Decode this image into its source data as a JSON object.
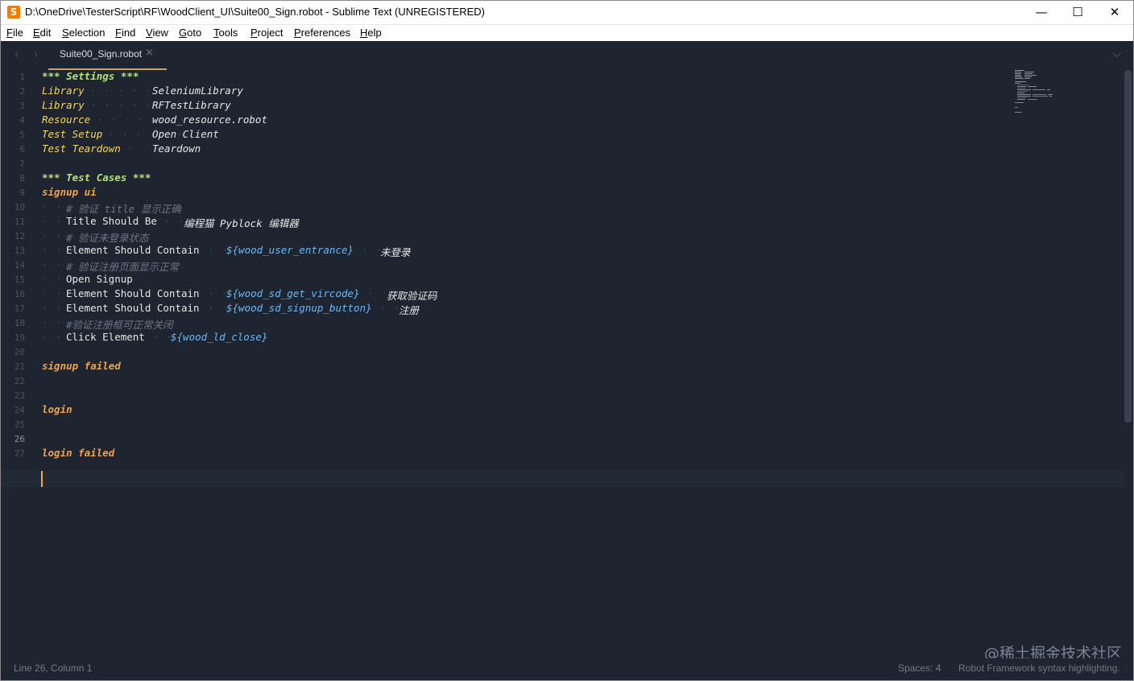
{
  "window": {
    "title": "D:\\OneDrive\\TesterScript\\RF\\WoodClient_UI\\Suite00_Sign.robot - Sublime Text (UNREGISTERED)",
    "app_icon": "sublime-s-logo",
    "minimize_glyph": "—",
    "maximize_glyph": "☐",
    "close_glyph": "✕"
  },
  "menu": [
    "File",
    "Edit",
    "Selection",
    "Find",
    "View",
    "Goto",
    "Tools",
    "Project",
    "Preferences",
    "Help"
  ],
  "tabs": {
    "back_glyph": "‹",
    "forward_glyph": "›",
    "active_label": "Suite00_Sign.robot",
    "close_glyph": "×",
    "dropdown_glyph": "⌵"
  },
  "editor": {
    "line_numbers": [
      "1",
      "2",
      "3",
      "4",
      "5",
      "6",
      "7",
      "8",
      "9",
      "10",
      "11",
      "12",
      "13",
      "14",
      "15",
      "16",
      "17",
      "18",
      "19",
      "20",
      "21",
      "22",
      "23",
      "24",
      "25",
      "26",
      "27"
    ],
    "current_line": "26",
    "lines": {
      "l1": "*** Settings ***",
      "l2a": "Library",
      "l2b": "SeleniumLibrary",
      "l3a": "Library",
      "l3b": "RFTestLibrary",
      "l4a": "Resource",
      "l4b": "wood_resource.robot",
      "l5a": "Test Setup",
      "l5b": "Open Client",
      "l6a": "Test Teardown",
      "l6b": "Teardown",
      "l8": "*** Test Cases ***",
      "l9": "signup ui",
      "l10": "# 验证 title 显示正确",
      "l11a": "Title Should Be",
      "l11b": "编程猫 Pyblock 编辑器",
      "l12": "# 验证未登录状态",
      "l13a": "Element Should Contain",
      "l13b": "${wood_user_entrance}",
      "l13c": "未登录",
      "l14": "# 验证注册页面显示正常",
      "l15": "Open Signup",
      "l16a": "Element Should Contain",
      "l16b": "${wood_sd_get_vircode}",
      "l16c": "获取验证码",
      "l17a": "Element Should Contain",
      "l17b": "${wood_sd_signup_button}",
      "l17c": "注册",
      "l18": "#验证注册框可正常关闭",
      "l19a": "Click Element",
      "l19b": "${wood_ld_close}",
      "l21": "signup failed",
      "l24": "login",
      "l27": "login failed"
    }
  },
  "status": {
    "position": "Line 26, Column 1",
    "spaces": "Spaces: 4",
    "syntax": "Robot Framework syntax highlighting."
  },
  "watermark": "@稀土掘金技术社区",
  "colors": {
    "background": "#1e2530",
    "keyword": "#f5d565",
    "section": "#b7e07d",
    "testcase": "#e9a356",
    "variable": "#6fb6f2",
    "comment": "#6c7585",
    "cursor": "#f5a742"
  }
}
